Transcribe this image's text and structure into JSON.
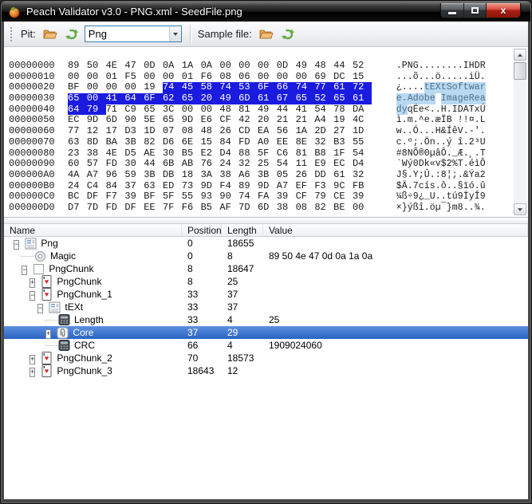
{
  "window": {
    "title": "Peach Validator v3.0 - PNG.xml - SeedFile.png",
    "controls": [
      "minimize",
      "maximize",
      "close"
    ]
  },
  "toolbar": {
    "pit_label": "Pit:",
    "pit_dropdown_value": "Png",
    "sample_file_label": "Sample file:"
  },
  "hex_view": {
    "rows": [
      {
        "offset": "00000000",
        "bytes": "89 50 4E 47 0D 0A 1A 0A 00 00 00 0D 49 48 44 52",
        "ascii": ".PNG........IHDR",
        "sel": [
          0,
          0
        ]
      },
      {
        "offset": "00000010",
        "bytes": "00 00 01 F5 00 00 01 F6 08 06 00 00 00 69 DC 15",
        "ascii": "...õ...ö.....iÜ.",
        "sel": [
          0,
          0
        ]
      },
      {
        "offset": "00000020",
        "bytes": "BF 00 00 00 19 74 45 58 74 53 6F 66 74 77 61 72",
        "ascii": "¿....tEXtSoftwar",
        "sel": [
          5,
          16
        ]
      },
      {
        "offset": "00000030",
        "bytes": "65 00 41 64 6F 62 65 20 49 6D 61 67 65 52 65 61",
        "ascii": "e.Adobe ImageRea",
        "sel": [
          0,
          16
        ]
      },
      {
        "offset": "00000040",
        "bytes": "64 79 71 C9 65 3C 00 00 48 81 49 44 41 54 78 DA",
        "ascii": "dyqÉe<..H.IDATxÚ",
        "sel": [
          0,
          2
        ]
      },
      {
        "offset": "00000050",
        "bytes": "EC 9D 6D 90 5E 65 9D E6 CF 42 20 21 21 A4 19 4C",
        "ascii": "ì.m.^e.æÏB !!¤.L",
        "sel": [
          0,
          0
        ]
      },
      {
        "offset": "00000060",
        "bytes": "77 12 17 D3 1D 07 08 48 26 CD EA 56 1A 2D 27 1D",
        "ascii": "w..Ó...H&ÍêV.-'.",
        "sel": [
          0,
          0
        ]
      },
      {
        "offset": "00000070",
        "bytes": "63 8D BA 3B 82 D6 6E 15 84 FD A0 EE 8E 32 B3 55",
        "ascii": "c.º;.Ön..ý î.2³U",
        "sel": [
          0,
          0
        ]
      },
      {
        "offset": "00000080",
        "bytes": "23 38 4E D5 AE 30 B5 E2 D4 88 5F C6 81 B8 1F 54",
        "ascii": "#8NÕ®0µâÔ._Æ.¸.T",
        "sel": [
          0,
          0
        ]
      },
      {
        "offset": "00000090",
        "bytes": "60 57 FD 30 44 6B AB 76 24 32 25 54 11 E9 EC D4",
        "ascii": "`Wý0Dk«v$2%T.éìÔ",
        "sel": [
          0,
          0
        ]
      },
      {
        "offset": "000000A0",
        "bytes": "4A A7 96 59 3B DB 18 3A 38 A6 3B 05 26 DD 61 32",
        "ascii": "J§.Y;Û.:8¦;.&Ýa2",
        "sel": [
          0,
          0
        ]
      },
      {
        "offset": "000000B0",
        "bytes": "24 C4 84 37 63 ED 73 9D F4 89 9D A7 EF F3 9C FB",
        "ascii": "$Ä.7cís.ô..§ïó.û",
        "sel": [
          0,
          0
        ]
      },
      {
        "offset": "000000C0",
        "bytes": "BC DF F7 39 BF 5F 55 93 90 74 FA 39 CF 79 CE 39",
        "ascii": "¼ß÷9¿_U..tú9ÏyÎ9",
        "sel": [
          0,
          0
        ]
      },
      {
        "offset": "000000D0",
        "bytes": "D7 7D FD DF EE 7F F6 B5 AF 7D 6D 38 08 82 BE 00",
        "ascii": "×}ýßî.öµ¯}m8..¾.",
        "sel": [
          0,
          0
        ]
      }
    ]
  },
  "grid": {
    "columns": [
      "Name",
      "Position",
      "Length",
      "Value"
    ],
    "rows": [
      {
        "indent": 0,
        "expander": "minus",
        "icon": "form",
        "name": "Png",
        "position": "0",
        "length": "18655",
        "value": "",
        "selected": false
      },
      {
        "indent": 1,
        "expander": null,
        "icon": "disc",
        "name": "Magic",
        "position": "0",
        "length": "8",
        "value": "89 50 4e 47 0d 0a 1a 0a",
        "selected": false
      },
      {
        "indent": 1,
        "expander": "minus",
        "icon": "square",
        "name": "PngChunk",
        "position": "8",
        "length": "18647",
        "value": "",
        "selected": false
      },
      {
        "indent": 2,
        "expander": "plus",
        "icon": "card",
        "name": "PngChunk",
        "position": "8",
        "length": "25",
        "value": "",
        "selected": false
      },
      {
        "indent": 2,
        "expander": "minus",
        "icon": "card",
        "name": "PngChunk_1",
        "position": "33",
        "length": "37",
        "value": "",
        "selected": false
      },
      {
        "indent": 3,
        "expander": "minus",
        "icon": "form",
        "name": "tEXt",
        "position": "33",
        "length": "37",
        "value": "",
        "selected": false
      },
      {
        "indent": 4,
        "expander": null,
        "icon": "calc",
        "name": "Length",
        "position": "33",
        "length": "4",
        "value": "25",
        "selected": false
      },
      {
        "indent": 4,
        "expander": "plus",
        "icon": "clip",
        "name": "Core",
        "position": "37",
        "length": "29",
        "value": "",
        "selected": true
      },
      {
        "indent": 4,
        "expander": null,
        "icon": "calc",
        "name": "CRC",
        "position": "66",
        "length": "4",
        "value": "1909024060",
        "selected": false
      },
      {
        "indent": 2,
        "expander": "plus",
        "icon": "card",
        "name": "PngChunk_2",
        "position": "70",
        "length": "18573",
        "value": "",
        "selected": false
      },
      {
        "indent": 2,
        "expander": "plus",
        "icon": "card",
        "name": "PngChunk_3",
        "position": "18643",
        "length": "12",
        "value": "",
        "selected": false
      }
    ]
  },
  "colors": {
    "hex_selection_bg": "#1b1be0",
    "ascii_selection_bg": "#b9d9f0",
    "ascii_selection_fg": "#49708c",
    "grid_selection_bg": "#2e6fd8",
    "combo_focus_border": "#3c7fb1",
    "close_button_red": "#aa1f12",
    "folder_icon_orange": "#e89a3c",
    "refresh_icon_green": "#62aa46"
  }
}
